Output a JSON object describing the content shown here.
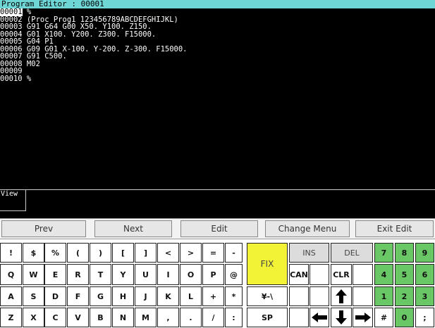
{
  "title": "Program Editor : 00001",
  "editor": {
    "lines": [
      {
        "num": "00001",
        "text": " %"
      },
      {
        "num": "00002",
        "text": " (Proc Prog1_123456789ABCDEFGHIJKL)"
      },
      {
        "num": "00003",
        "text": " G91 G64 G00 X50. Y100. Z150."
      },
      {
        "num": "00004",
        "text": " G01 X100. Y200. Z300. F15000."
      },
      {
        "num": "00005",
        "text": " G04 P1"
      },
      {
        "num": "00006",
        "text": " G09 G01 X-100. Y-200. Z-300. F15000."
      },
      {
        "num": "00007",
        "text": " G91 C500."
      },
      {
        "num": "00008",
        "text": " M02"
      },
      {
        "num": "00009",
        "text": ""
      },
      {
        "num": "00010",
        "text": " %"
      }
    ]
  },
  "view": {
    "label": "View"
  },
  "function_keys": {
    "prev": "Prev",
    "next": "Next",
    "edit": "Edit",
    "change_menu": "Change Menu",
    "exit_edit": "Exit Edit"
  },
  "keys": {
    "row1": [
      "!",
      "$",
      "%",
      "(",
      ")",
      "[",
      "]",
      "<",
      ">",
      "=",
      "-"
    ],
    "row2": [
      "Q",
      "W",
      "E",
      "R",
      "T",
      "Y",
      "U",
      "I",
      "O",
      "P",
      "@"
    ],
    "row3": [
      "A",
      "S",
      "D",
      "F",
      "G",
      "H",
      "J",
      "K",
      "L",
      "+",
      "*"
    ],
    "row4": [
      "Z",
      "X",
      "C",
      "V",
      "B",
      "N",
      "M",
      ",",
      ".",
      "/",
      ":"
    ],
    "fix": "FIX",
    "ins": "INS",
    "del": "DEL",
    "can": "CAN",
    "clr": "CLR",
    "yen": "¥-\\",
    "sp": "SP",
    "hash": "#",
    "semicolon": ";",
    "numpad": [
      "7",
      "8",
      "9",
      "4",
      "5",
      "6",
      "1",
      "2",
      "3",
      "0"
    ]
  },
  "colors": {
    "title_bar": "#6fd6d6",
    "numpad": "#69c765",
    "fix": "#f2f236"
  }
}
